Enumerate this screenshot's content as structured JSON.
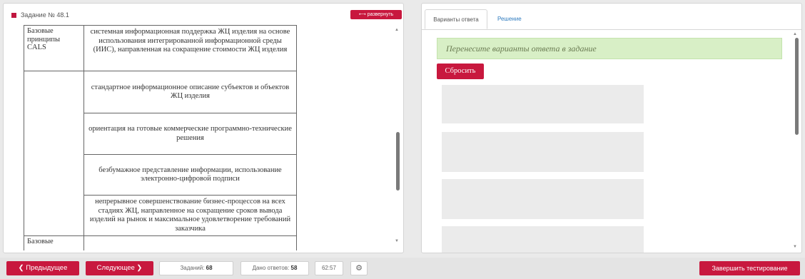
{
  "task_panel": {
    "title": "Задание № 48.1",
    "expand_label": "развернуть",
    "table": {
      "rows": [
        {
          "left": "Базовые принципы CALS",
          "right": "системная информационная поддержка ЖЦ изделия на основе использования интегрированной информационной среды (ИИС), направленная на сокращение стоимости ЖЦ изделия"
        },
        {
          "left": "",
          "right": "стандартное информационное описание субъектов и объектов ЖЦ изделия"
        },
        {
          "left": "",
          "right": "ориентация на готовые коммерческие программно-технические решения"
        },
        {
          "left": "",
          "right": "безбумажное представление информации, использование электронно-цифровой подписи"
        },
        {
          "left": "",
          "right": "непрерывное совершенствование бизнес-процессов на всех стадиях ЖЦ, направленное на сокращение сроков вывода изделий на рынок и максимальное удовлетворение требований заказчика"
        },
        {
          "left": "Базовые",
          "right": ""
        }
      ]
    }
  },
  "answer_panel": {
    "tabs": [
      "Варианты ответа",
      "Решение"
    ],
    "notice": "Перенесите варианты ответа в задание",
    "reset_label": "Сбросить"
  },
  "bottom_bar": {
    "prev_label": "Предыдущее",
    "next_label": "Следующее",
    "tasks_label": "Заданий:",
    "tasks_count": "68",
    "answers_label": "Дано ответов:",
    "answers_count": "58",
    "timer": "62:57",
    "finish_label": "Завершить тестирование"
  },
  "colors": {
    "accent": "#c8183e",
    "notice_bg": "#d8efc6",
    "link": "#2f7bbf"
  },
  "icons": [
    "square-marker-icon",
    "expand-arrows-icon",
    "chevron-left-icon",
    "chevron-right-icon",
    "gear-icon",
    "scroll-up-icon",
    "scroll-down-icon"
  ]
}
